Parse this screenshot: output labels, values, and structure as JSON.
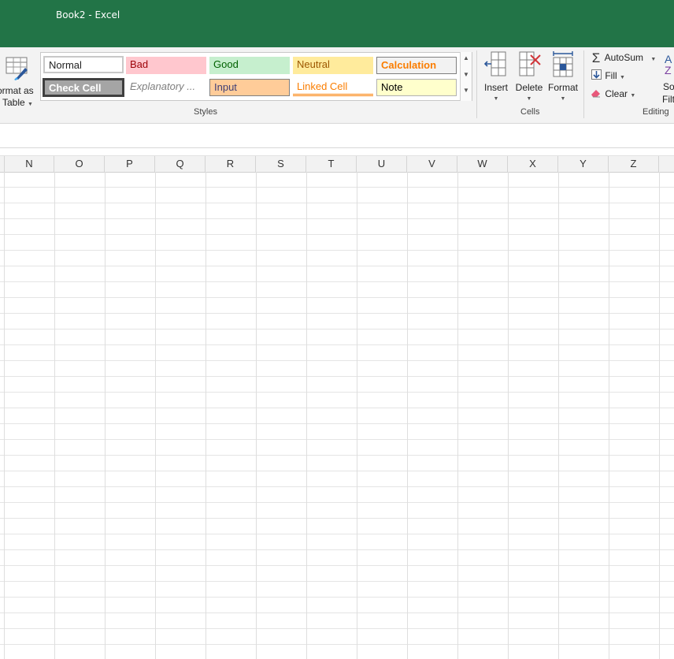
{
  "window": {
    "title": "Book2 - Excel"
  },
  "ribbon": {
    "format_as_table": {
      "line1": "ormat as",
      "line2": "Table",
      "icon": "format-as-table-icon"
    },
    "styles": {
      "group_label": "Styles",
      "items": [
        {
          "name": "Normal",
          "bg": "#ffffff",
          "fg": "#000000"
        },
        {
          "name": "Bad",
          "bg": "#ffc7ce",
          "fg": "#9c0006"
        },
        {
          "name": "Good",
          "bg": "#c6efce",
          "fg": "#006100"
        },
        {
          "name": "Neutral",
          "bg": "#ffeb9c",
          "fg": "#9c5700"
        },
        {
          "name": "Calculation",
          "bg": "#f2f2f2",
          "fg": "#fa7d00"
        },
        {
          "name": "Check Cell",
          "bg": "#a5a5a5",
          "fg": "#ffffff"
        },
        {
          "name": "Explanatory ...",
          "bg": "#ffffff",
          "fg": "#7f7f7f"
        },
        {
          "name": "Input",
          "bg": "#ffcc99",
          "fg": "#3f3f76"
        },
        {
          "name": "Linked Cell",
          "bg": "#ffffff",
          "fg": "#fa7d00"
        },
        {
          "name": "Note",
          "bg": "#ffffcc",
          "fg": "#000000"
        }
      ]
    },
    "cells": {
      "group_label": "Cells",
      "insert": "Insert",
      "delete": "Delete",
      "format": "Format"
    },
    "editing": {
      "group_label": "Editing",
      "autosum": "AutoSum",
      "fill": "Fill",
      "clear": "Clear",
      "sort_line1": "So",
      "sort_line2": "Filt"
    }
  },
  "sheet": {
    "columns": [
      "N",
      "O",
      "P",
      "Q",
      "R",
      "S",
      "T",
      "U",
      "V",
      "W",
      "X",
      "Y",
      "Z"
    ]
  },
  "colors": {
    "title_bar": "#227447",
    "ribbon_bg": "#f3f3f3",
    "grid_line": "#dedede"
  }
}
